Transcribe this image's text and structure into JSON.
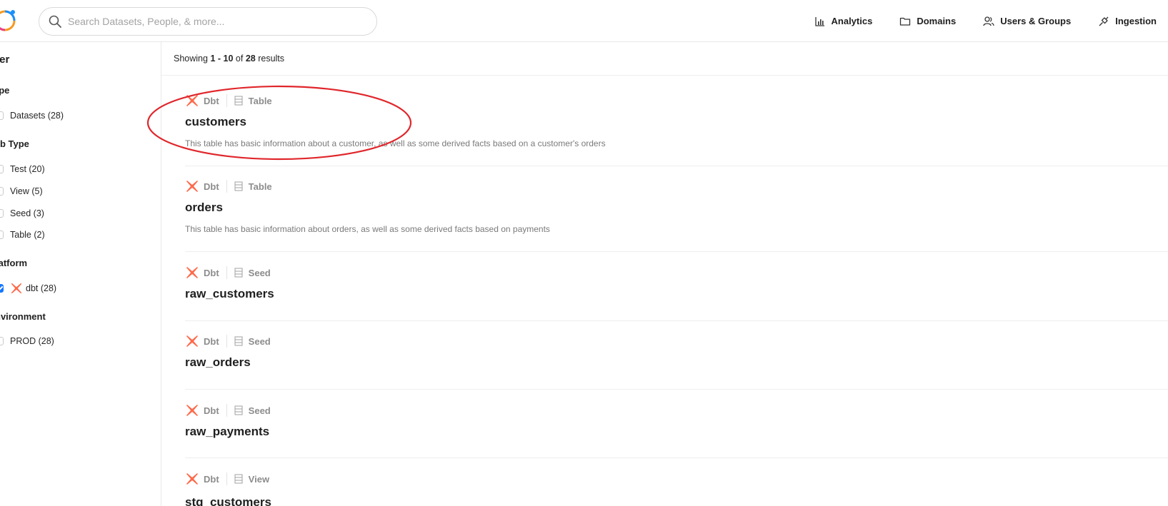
{
  "header": {
    "search_placeholder": "Search Datasets, People, & more...",
    "nav": [
      "Analytics",
      "Domains",
      "Users & Groups",
      "Ingestion"
    ]
  },
  "sidebar": {
    "title": "lter",
    "sections": [
      {
        "title": "ype",
        "options": [
          "Datasets (28)"
        ]
      },
      {
        "title": "ub Type",
        "options": [
          "Test (20)",
          "View (5)",
          "Seed (3)",
          "Table (2)"
        ]
      },
      {
        "title": "latform",
        "options": [
          "dbt (28)"
        ]
      },
      {
        "title": "nvironment",
        "options": [
          "PROD (28)"
        ]
      }
    ]
  },
  "summary": {
    "prefix": "Showing",
    "range": "1 - 10",
    "of": "of",
    "total": "28",
    "suffix": "results"
  },
  "results": [
    {
      "platform": "Dbt",
      "subtype": "Table",
      "name": "customers",
      "description": "This table has basic information about a customer, as well as some derived facts based on a customer's orders"
    },
    {
      "platform": "Dbt",
      "subtype": "Table",
      "name": "orders",
      "description": "This table has basic information about orders, as well as some derived facts based on payments"
    },
    {
      "platform": "Dbt",
      "subtype": "Seed",
      "name": "raw_customers",
      "description": ""
    },
    {
      "platform": "Dbt",
      "subtype": "Seed",
      "name": "raw_orders",
      "description": ""
    },
    {
      "platform": "Dbt",
      "subtype": "Seed",
      "name": "raw_payments",
      "description": ""
    },
    {
      "platform": "Dbt",
      "subtype": "View",
      "name": "stg_customers",
      "description": ""
    }
  ],
  "colors": {
    "dbt": "#ff694a",
    "checkbox": "#1677ff",
    "annotation": "#e0262b"
  }
}
